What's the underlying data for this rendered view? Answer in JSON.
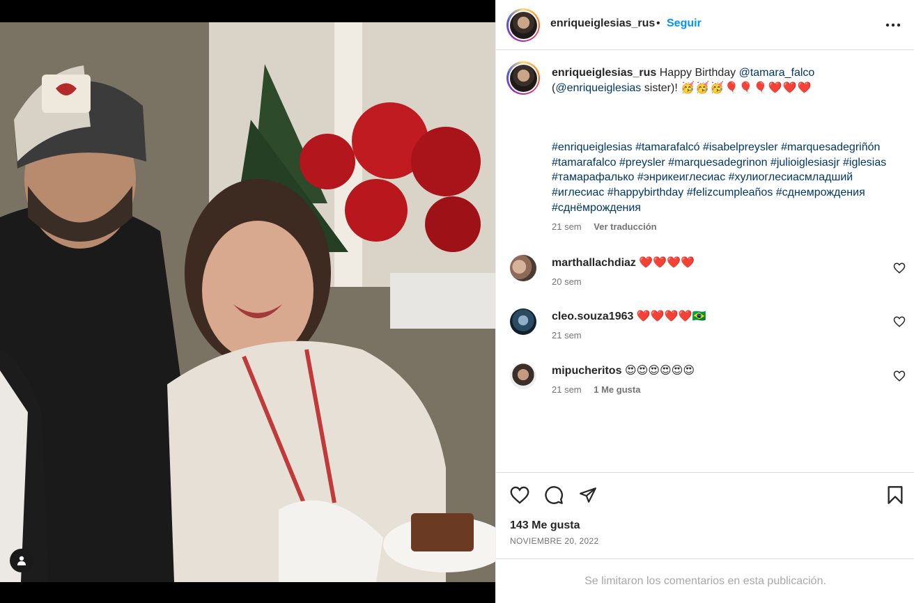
{
  "post": {
    "username": "enriqueiglesias_rus",
    "separator": "•",
    "follow_label": "Seguir",
    "more_icon": "more-horizontal-icon"
  },
  "caption": {
    "username": "enriqueiglesias_rus",
    "text_before": "Happy Birthday",
    "mention_1": "@tamara_falco",
    "paren_open": "(",
    "mention_2": "@enriqueiglesias",
    "text_after": "sister)!",
    "emojis": "🥳🥳🥳🎈🎈🎈❤️❤️❤️",
    "hashtags": "#enriqueiglesias #tamarafalcó #isabelpreysler #marquesadegriñón #tamarafalco #preysler #marquesadegrinon #julioiglesiasjr #iglesias #тамарафалько #энрикеиглесиас #хулиоглесиасмладший #иглесиас #happybirthday #felizcumpleaños #сднемрождения #сднёмрождения",
    "time": "21 sem",
    "translate_label": "Ver traducción"
  },
  "comments": [
    {
      "username": "marthallachdiaz",
      "text": "❤️❤️❤️❤️",
      "time": "20 sem",
      "likes": ""
    },
    {
      "username": "cleo.souza1963",
      "text": "❤️❤️❤️❤️🇧🇷",
      "time": "21 sem",
      "likes": ""
    },
    {
      "username": "mipucheritos",
      "text": "😍😍😍😍😍😍",
      "time": "21 sem",
      "likes": "1 Me gusta"
    }
  ],
  "actions": {
    "likes_count": "143 Me gusta",
    "date": "NOVIEMBRE 20, 2022"
  },
  "footer": {
    "notice": "Se limitaron los comentarios en esta publicación."
  }
}
